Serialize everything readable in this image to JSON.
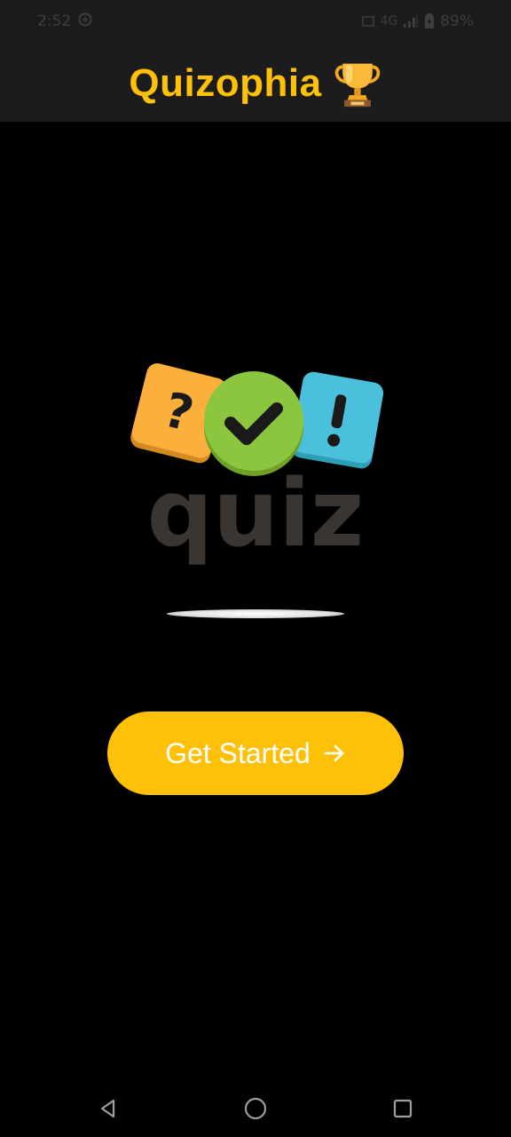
{
  "status_bar": {
    "time": "2:52",
    "network": "4G",
    "battery": "89%",
    "icons": [
      "sync-icon",
      "volte-icon",
      "signal-icon",
      "battery-icon"
    ]
  },
  "app_bar": {
    "title": "Quizophia",
    "title_icon": "trophy-icon"
  },
  "logo": {
    "wordmark": "quiz",
    "badges": [
      "?",
      "check",
      "!"
    ],
    "colors": {
      "question": "#fbb03b",
      "check": "#8cc63f",
      "exclaim": "#4bc0dc",
      "wordmark": "#3a3530"
    }
  },
  "main": {
    "get_started_label": "Get Started",
    "get_started_icon": "arrow-right-icon"
  },
  "nav_bar": {
    "items": [
      "back-icon",
      "home-icon",
      "recents-icon"
    ]
  },
  "colors": {
    "accent": "#ffc107",
    "app_bar_bg": "#1c1c1c",
    "background": "#000000"
  }
}
